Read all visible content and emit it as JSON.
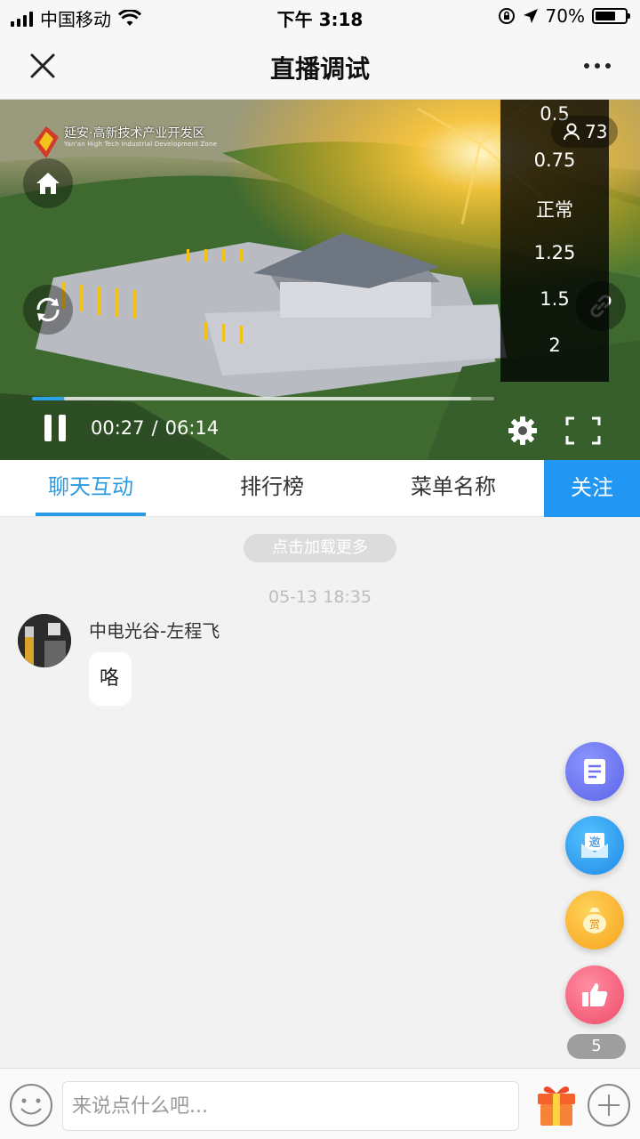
{
  "status_bar": {
    "carrier": "中国移动",
    "time": "下午 3:18",
    "battery_text": "70%",
    "battery_level": 0.7
  },
  "nav": {
    "title": "直播调试",
    "close_icon": "close-icon",
    "more_icon": "more-icon"
  },
  "video": {
    "logo_text": "延安·高新技术产业开发区",
    "logo_sub": "Yan'an High Tech Industrial Development Zone",
    "viewer_count": "73",
    "speed_options": [
      "0.5",
      "0.75",
      "正常",
      "1.25",
      "1.5",
      "2"
    ],
    "current_time": "00:27",
    "separator": "/",
    "duration": "06:14",
    "progress_played": 0.07,
    "progress_buffered": 0.95
  },
  "tabs": {
    "items": [
      "聊天互动",
      "排行榜",
      "菜单名称"
    ],
    "active_index": 0,
    "follow_label": "关注"
  },
  "chat": {
    "load_more": "点击加载更多",
    "messages": [
      {
        "timestamp": "05-13 18:35",
        "sender": "中电光谷-左程飞",
        "text": "咯"
      }
    ]
  },
  "fabs": {
    "invite_glyph": "邀",
    "reward_glyph": "赏",
    "like_count": "5"
  },
  "input_bar": {
    "placeholder": "来说点什么吧..."
  },
  "colors": {
    "accent": "#2a9be2",
    "follow_bg": "#2196f3"
  }
}
